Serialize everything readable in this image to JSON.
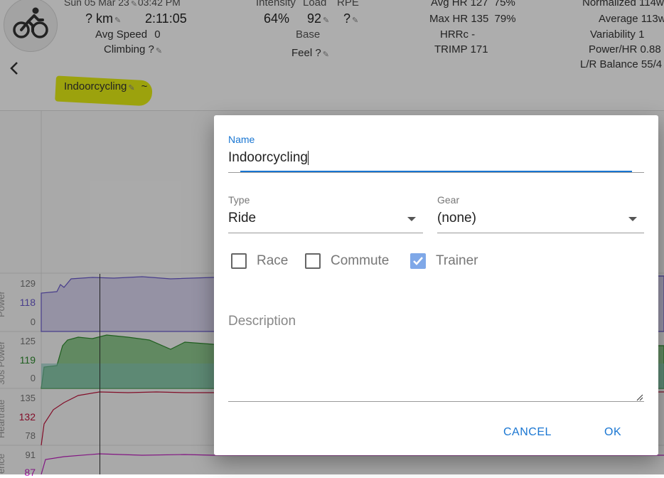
{
  "header": {
    "date": "Sun 05 Mar 23",
    "time": "03:42 PM",
    "distance": "? km",
    "duration": "2:11:05",
    "avg_speed_label": "Avg Speed",
    "avg_speed_value": "0",
    "climbing_label": "Climbing",
    "climbing_value": "?",
    "intensity_label": "Intensity",
    "intensity_value": "64%",
    "load_label": "Load",
    "load_value": "92",
    "rpe_label": "RPE",
    "rpe_value": "?",
    "base_label": "Base",
    "feel_label": "Feel",
    "feel_value": "?",
    "avg_hr_label": "Avg HR",
    "avg_hr_value": "127",
    "avg_hr_pct": "75%",
    "max_hr_label": "Max HR",
    "max_hr_value": "135",
    "max_hr_pct": "79%",
    "hrrc_label": "HRRc",
    "hrrc_value": "-",
    "trimp_label": "TRIMP",
    "trimp_value": "171",
    "normalized_label": "Normalized",
    "normalized_value": "114w",
    "average_label": "Average",
    "average_value": "113w",
    "variability_label": "Variability",
    "variability_value": "1",
    "power_hr_label": "Power/HR",
    "power_hr_value": "0.88",
    "lr_balance_label": "L/R Balance",
    "lr_balance_value": "55/4",
    "activity_name": "Indoorcycling",
    "activity_suffix": "~"
  },
  "charts": {
    "power": {
      "label": "Power",
      "ticks": [
        "129",
        "118",
        "0"
      ],
      "color": "#6a5acd"
    },
    "power30s": {
      "label": "30s Power",
      "ticks": [
        "125",
        "119",
        "0"
      ],
      "color": "#2e8b2e"
    },
    "heartrate": {
      "label": "Heartrate",
      "ticks": [
        "135",
        "132",
        "78"
      ],
      "color": "#c0143c"
    },
    "cadence": {
      "label": "ence",
      "ticks": [
        "91",
        "87"
      ],
      "color": "#c020c0"
    }
  },
  "dialog": {
    "name_label": "Name",
    "name_value": "Indoorcycling",
    "type_label": "Type",
    "type_value": "Ride",
    "gear_label": "Gear",
    "gear_value": "(none)",
    "race_label": "Race",
    "race_checked": false,
    "commute_label": "Commute",
    "commute_checked": false,
    "trainer_label": "Trainer",
    "trainer_checked": true,
    "description_placeholder": "Description",
    "cancel_label": "CANCEL",
    "ok_label": "OK"
  },
  "icons": {
    "sport": "bicycle-icon",
    "back": "chevron-left-icon",
    "edit": "pencil-icon",
    "dropdown": "caret-down-icon",
    "check": "check-icon",
    "resize": "resize-handle-icon"
  },
  "colors": {
    "accent": "#1976d2",
    "highlight": "#e6ef14",
    "checkbox_checked": "#7fa8e8"
  }
}
